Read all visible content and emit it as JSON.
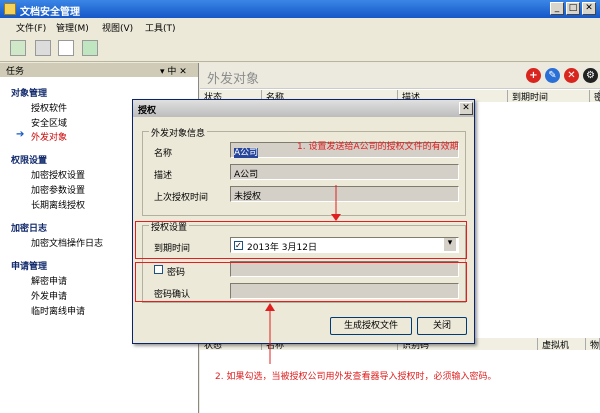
{
  "window": {
    "title": "文档安全管理"
  },
  "menu": [
    "文件(F)",
    "管理(M)",
    "视图(V)",
    "工具(T)"
  ],
  "side": {
    "header": "任务",
    "header_controls": "▾ 中 ✕",
    "sections": [
      {
        "title": "对象管理",
        "items": [
          "授权软件",
          "安全区域",
          "外发对象"
        ]
      },
      {
        "title": "权限设置",
        "items": [
          "加密授权设置",
          "加密参数设置",
          "长期离线授权"
        ]
      },
      {
        "title": "加密日志",
        "items": [
          "加密文档操作日志"
        ]
      },
      {
        "title": "申请管理",
        "items": [
          "解密申请",
          "外发申请",
          "临时离线申请"
        ]
      }
    ],
    "active_item": "外发对象"
  },
  "main": {
    "title": "外发对象",
    "columns": [
      "状态",
      "名称",
      "描述",
      "到期时间",
      "密"
    ],
    "lower_columns": [
      "状态",
      "名称",
      "识别码",
      "虚拟机",
      "物"
    ]
  },
  "dialog": {
    "title": "授权",
    "group1": "外发对象信息",
    "name_label": "名称",
    "name_value": "A公司",
    "desc_label": "描述",
    "desc_value": "A公司",
    "last_label": "上次授权时间",
    "last_value": "未授权",
    "group2": "授权设置",
    "expire_label": "到期时间",
    "expire_value": "2013年 3月12日",
    "password_label": "密码",
    "confirm_label": "密码确认",
    "generate_button": "生成授权文件",
    "close_button": "关闭"
  },
  "annotations": {
    "note1": "1. 设置发送给A公司的授权文件的有效期",
    "note2": "2. 如果勾选，当被授权公司用外发查看器导入授权时，必须输入密码。"
  },
  "colors": {
    "accent": "#1557c7",
    "annotation": "#e02020",
    "active_item": "#cc0000"
  }
}
